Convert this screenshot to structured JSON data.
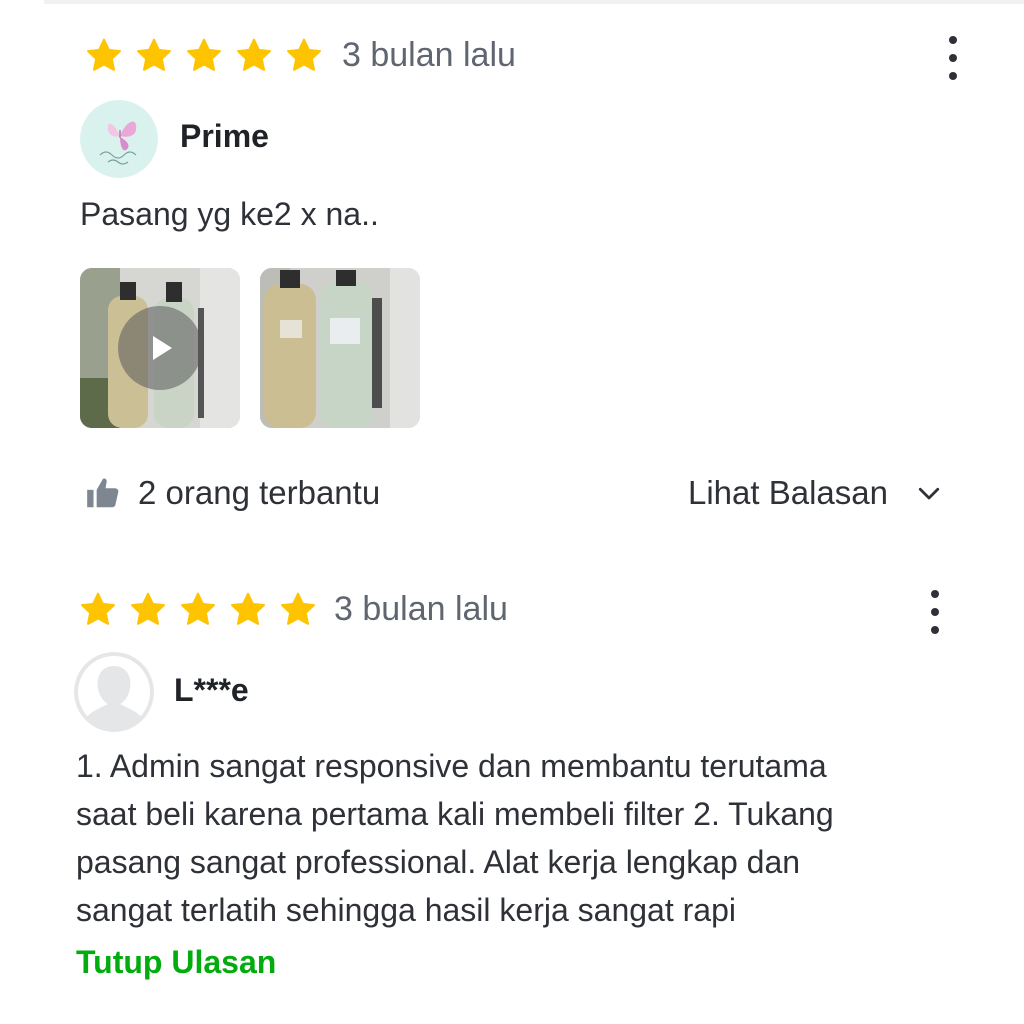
{
  "accent_color": "#03ac0e",
  "star_color": "#ffc400",
  "reviews": [
    {
      "rating": 5,
      "time_ago": "3 bulan lalu",
      "username": "Prime",
      "avatar_icon": "butterfly-avatar-icon",
      "text": "Pasang yg ke2 x na..",
      "media": [
        {
          "type": "video",
          "icon": "play-icon"
        },
        {
          "type": "image"
        }
      ],
      "helpful_icon": "thumbs-up-icon",
      "helpful_count_text": "2 orang terbantu",
      "see_replies_label": "Lihat Balasan",
      "see_replies_icon": "chevron-down-icon",
      "menu_icon": "more-vertical-icon"
    },
    {
      "rating": 5,
      "time_ago": "3 bulan lalu",
      "username": "L***e",
      "avatar_icon": "default-user-avatar-icon",
      "text_lines": [
        "1. Admin sangat responsive dan membantu terutama",
        "saat beli karena pertama kali membeli filter 2. Tukang",
        "pasang sangat professional. Alat kerja lengkap dan",
        "sangat terlatih sehingga hasil kerja sangat rapi"
      ],
      "collapse_label": "Tutup Ulasan",
      "menu_icon": "more-vertical-icon"
    }
  ]
}
